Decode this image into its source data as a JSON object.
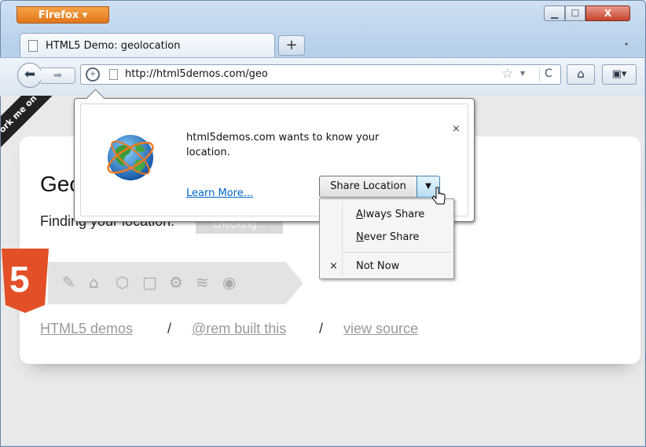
{
  "browser": {
    "app_button": "Firefox",
    "window_controls": {
      "minimize": "▁",
      "maximize": "☐",
      "close": "X"
    },
    "tab": {
      "title": "HTML5 Demo: geolocation"
    },
    "new_tab": "+",
    "tab_list": "▾",
    "url": "http://html5demos.com/geo"
  },
  "page": {
    "ribbon": "Fork me on GitHub",
    "heading": "Geolocation",
    "finding_label": "Finding your location:",
    "status": "checking...",
    "html5_logo_mark": "5",
    "footer": {
      "demos": "HTML5 demos",
      "sep1": "/",
      "built": "@rem built this",
      "sep2": "/",
      "source": "view source"
    }
  },
  "popup": {
    "message": "html5demos.com wants to know your location.",
    "learn_more": "Learn More...",
    "close": "×",
    "share_button": "Share Location",
    "dropdown_arrow": "▼"
  },
  "menu": {
    "always_share": {
      "underlined": "A",
      "rest": "lways Share"
    },
    "never_share": {
      "underlined": "N",
      "rest": "ever Share"
    },
    "not_now": "Not Now",
    "not_now_mark": "×"
  }
}
